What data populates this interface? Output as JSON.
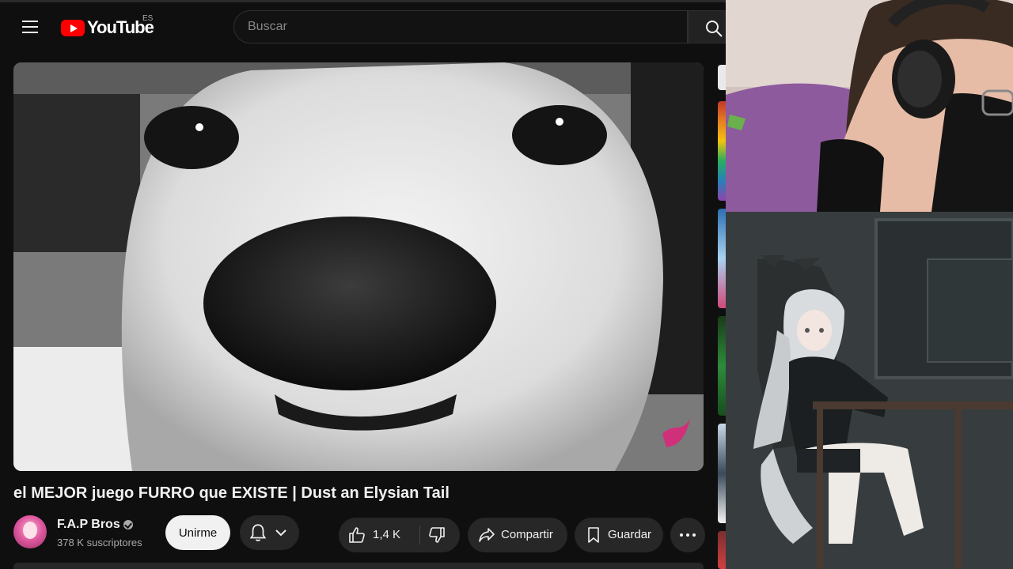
{
  "masthead": {
    "logo_text": "YouTube",
    "country_code": "ES",
    "search_placeholder": "Buscar"
  },
  "video": {
    "title": "el MEJOR juego FURRO que EXISTE | Dust an Elysian Tail"
  },
  "channel": {
    "name": "F.A.P Bros",
    "subscribers": "378 K suscriptores",
    "join_label": "Unirme"
  },
  "actions": {
    "like_count": "1,4 K",
    "share_label": "Compartir",
    "save_label": "Guardar"
  },
  "colors": {
    "background": "#0f0f0f",
    "button_bg": "#272727",
    "brand_red": "#ff0000",
    "join_bg": "#f1f1f1"
  }
}
